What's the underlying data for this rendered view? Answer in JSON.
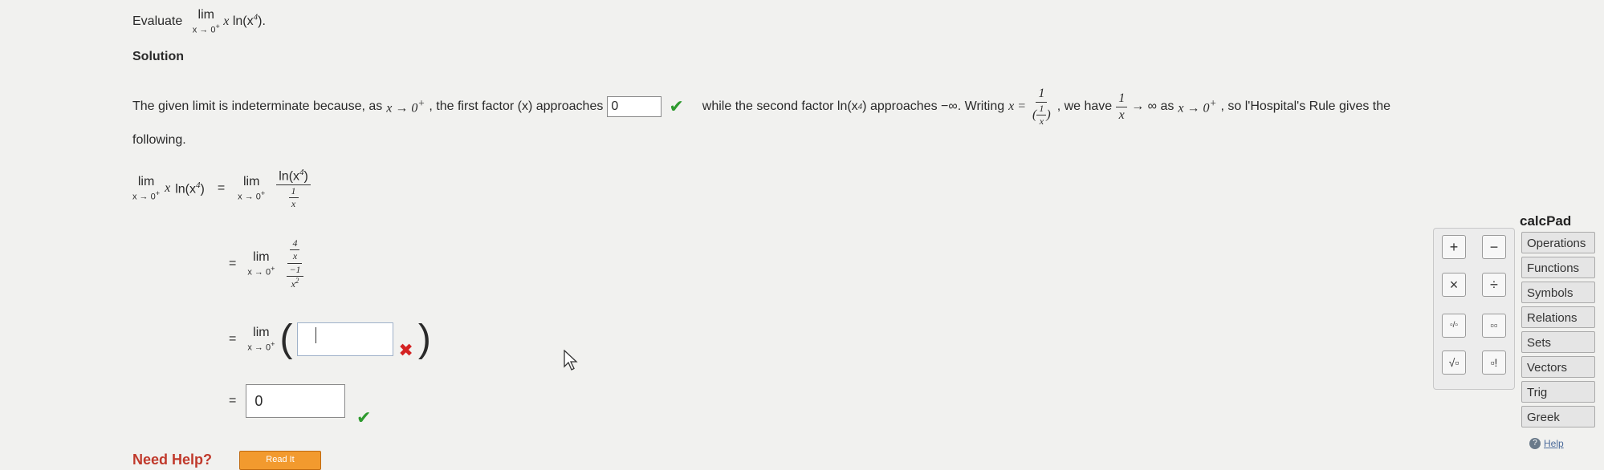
{
  "question": {
    "prefix": "Evaluate",
    "lim": "lim",
    "sub": "x → 0",
    "sup": "+",
    "expr_x": "x",
    "expr_ln": "ln(x",
    "expr_pow": "4",
    "expr_close": ")."
  },
  "solution": {
    "heading": "Solution",
    "p1_a": "The given limit is indeterminate because, as",
    "p1_b": ", the first factor (x) approaches",
    "box1_value": "0",
    "p1_c": "while the second factor ln(x",
    "p1_d": ") approaches −∞. Writing",
    "p1_e": ", we have",
    "p1_f": "→ ∞ as",
    "p1_g": ", so l'Hospital's Rule gives the",
    "p1_h": "following.",
    "x_to_0": "x → 0",
    "sup_plus": "+",
    "pow4": "4"
  },
  "steps": {
    "lim": "lim",
    "sub": "x → 0",
    "sup": "+",
    "lhs_x": "x",
    "lhs_ln": "ln(x",
    "pow4": "4",
    "close": ")",
    "eq": "=",
    "f1_num": "ln(x",
    "one": "1",
    "x": "x",
    "four": "4",
    "neg_one": "−1",
    "x2": "x",
    "two": "2",
    "box2_value": "",
    "box3_value": "0"
  },
  "calcpad": {
    "title": "calcPad",
    "buttons": [
      "+",
      "−",
      "×",
      "÷",
      "▫/▫",
      "▫▫",
      "√▫",
      "▫!"
    ],
    "tabs": [
      "Operations",
      "Functions",
      "Symbols",
      "Relations",
      "Sets",
      "Vectors",
      "Trig",
      "Greek"
    ],
    "help": "Help"
  },
  "footer": {
    "need_help": "Need Help?",
    "read_it": "Read It"
  },
  "colors": {
    "check": "#2e9a2e",
    "cross": "#d42222",
    "accent": "#c0392b"
  }
}
